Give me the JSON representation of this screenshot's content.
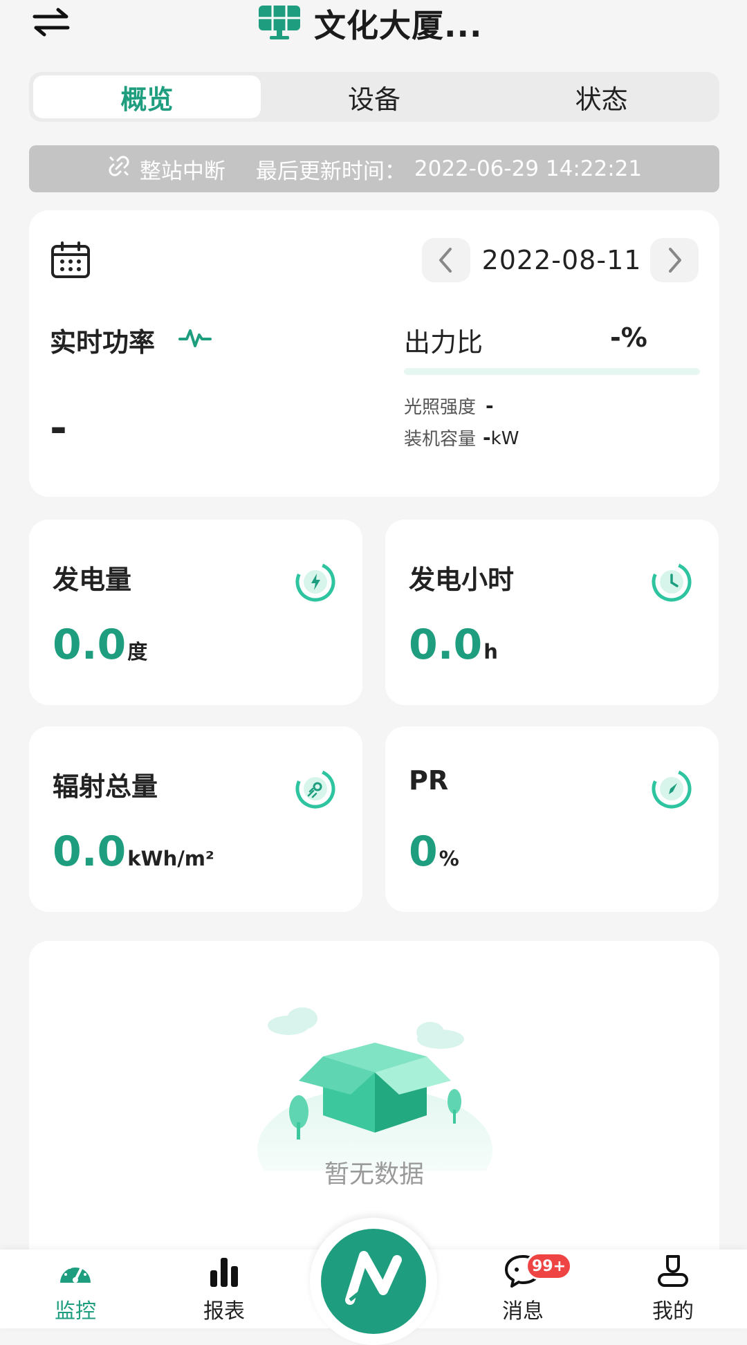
{
  "header": {
    "title": "文化大厦..."
  },
  "tabs": [
    {
      "label": "概览",
      "active": true
    },
    {
      "label": "设备",
      "active": false
    },
    {
      "label": "状态",
      "active": false
    }
  ],
  "banner": {
    "status": "整站中断",
    "update_label": "最后更新时间：",
    "update_time": "2022-06-29 14:22:21"
  },
  "overview": {
    "date": "2022-08-11",
    "realtime_label": "实时功率",
    "realtime_value": "-",
    "ratio_label": "出力比",
    "ratio_value": "-%",
    "ratio_fraction": 0,
    "light_label": "光照强度",
    "light_value": "-",
    "capacity_label": "装机容量",
    "capacity_value": "-",
    "capacity_unit": "kW"
  },
  "metrics": [
    {
      "label": "发电量",
      "value": "0.0",
      "unit": "度",
      "icon": "lightning-ring-icon"
    },
    {
      "label": "发电小时",
      "value": "0.0",
      "unit": "h",
      "icon": "clock-ring-icon"
    },
    {
      "label": "辐射总量",
      "value": "0.0",
      "unit": "kWh/m²",
      "icon": "sun-ring-icon"
    },
    {
      "label": "PR",
      "value": "0",
      "unit": "%",
      "icon": "compass-ring-icon"
    }
  ],
  "empty": {
    "text": "暂无数据"
  },
  "nav": {
    "items": [
      {
        "label": "监控",
        "active": true
      },
      {
        "label": "报表",
        "active": false
      },
      {
        "label": "消息",
        "active": false
      },
      {
        "label": "我的",
        "active": false
      }
    ],
    "badge": "99+"
  },
  "colors": {
    "accent": "#1e9e7e",
    "banner": "#c4c4c4",
    "badge": "#ef4444"
  }
}
